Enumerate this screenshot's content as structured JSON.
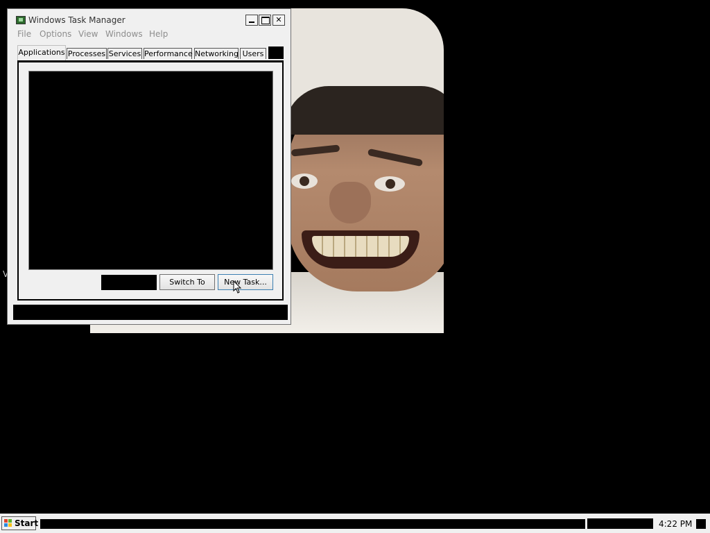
{
  "window": {
    "title": "Windows Task Manager",
    "controls": {
      "minimize": "",
      "maximize": "",
      "close": "✕"
    }
  },
  "menu": [
    "File",
    "Options",
    "View",
    "Windows",
    "Help"
  ],
  "tabs": [
    "Applications",
    "Processes",
    "Services",
    "Performance",
    "Networking",
    "Users"
  ],
  "active_tab": "Applications",
  "buttons": {
    "switch_to": "Switch To",
    "new_task": "New Task..."
  },
  "desktop": {
    "stray_text": "V"
  },
  "taskbar": {
    "start_label": "Start",
    "clock": "4:22 PM"
  },
  "colors": {
    "accent": "#3c7fb1",
    "menu_disabled": "#8d8d8d"
  }
}
